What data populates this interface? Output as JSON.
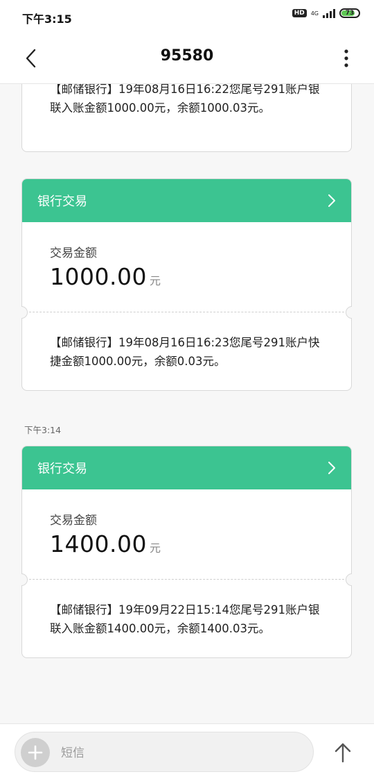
{
  "status": {
    "time": "下午3:15",
    "hd": "HD",
    "network": "4G",
    "battery": "73"
  },
  "header": {
    "title": "95580"
  },
  "messages": {
    "top_fragment": "【邮储银行】19年08月16日16:22您尾号291账户银联入账金额1000.00元，余额1000.03元。",
    "cards": [
      {
        "header_label": "银行交易",
        "amount_label": "交易金额",
        "amount": "1000.00",
        "unit": "元",
        "text": "【邮储银行】19年08月16日16:23您尾号291账户快捷金额1000.00元，余额0.03元。"
      },
      {
        "header_label": "银行交易",
        "amount_label": "交易金额",
        "amount": "1400.00",
        "unit": "元",
        "text": "【邮储银行】19年09月22日15:14您尾号291账户银联入账金额1400.00元，余额1400.03元。"
      }
    ],
    "timestamp2": "下午3:14"
  },
  "composer": {
    "placeholder": "短信"
  },
  "colors": {
    "accent": "#3cc491",
    "battery": "#5ec854"
  }
}
